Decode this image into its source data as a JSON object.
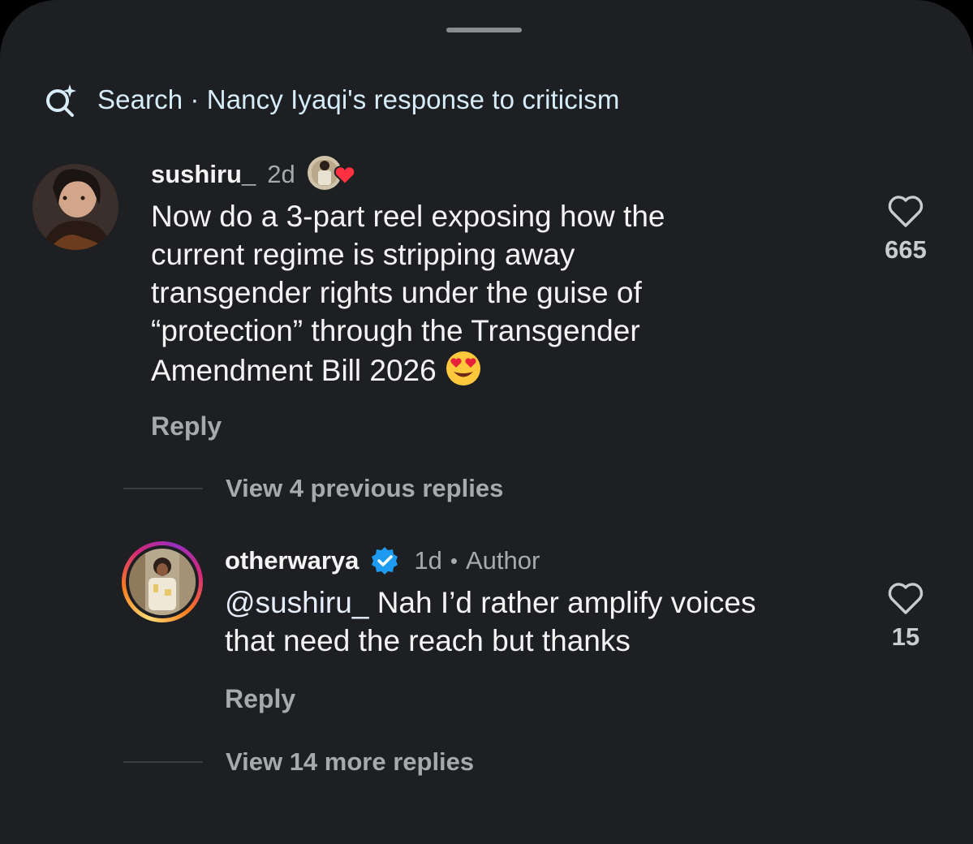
{
  "search": {
    "label": "Search · Nancy Iyaqi's response to criticism",
    "icon": "search-sparkle-icon"
  },
  "comments": [
    {
      "username": "sushiru_",
      "time": "2d",
      "liked_by_author": true,
      "text": "Now do a 3-part reel exposing how the current regime is stripping away transgender rights under the guise of “protection” through the Transgender Amendment Bill 2026",
      "lines": [
        "Now do a 3-part reel exposing how the",
        "current regime is stripping away",
        "transgender rights under the guise of",
        "“protection” through the Transgender",
        "Amendment Bill 2026"
      ],
      "emoji": "heart-eyes-emoji",
      "reply_label": "Reply",
      "like_count": "665"
    }
  ],
  "view_previous": "View 4 previous replies",
  "reply": {
    "username": "otherwarya",
    "verified": true,
    "time": "1d",
    "separator": "•",
    "author_label": "Author",
    "mention": "@sushiru_",
    "lines": [
      "Nah I’d rather amplify voices",
      "that need the reach but thanks"
    ],
    "reply_label": "Reply",
    "like_count": "15"
  },
  "view_more": "View 14 more replies",
  "colors": {
    "background": "#1d1f22",
    "text": "#f4f4f4",
    "muted": "#a7a9ac",
    "verified": "#1d9bf0",
    "heart": "#ff3040"
  }
}
